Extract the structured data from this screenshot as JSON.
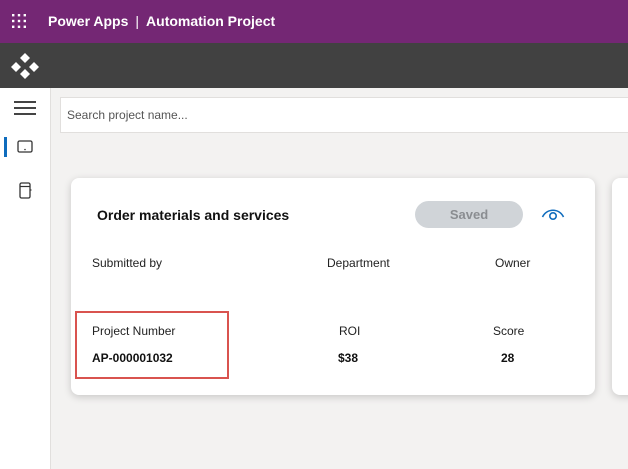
{
  "header": {
    "app_name": "Power Apps",
    "separator": "|",
    "project_title": "Automation Project"
  },
  "search": {
    "placeholder": "Search project name..."
  },
  "card": {
    "title": "Order materials and services",
    "saved_label": "Saved",
    "columns": {
      "submitted_by_label": "Submitted by",
      "department_label": "Department",
      "owner_label": "Owner",
      "project_number_label": "Project Number",
      "roi_label": "ROI",
      "score_label": "Score"
    },
    "values": {
      "project_number": "AP-000001032",
      "roi": "$38",
      "score": "28"
    }
  },
  "colors": {
    "header_bg": "#742774",
    "appbar_bg": "#414141",
    "highlight": "#d9534f",
    "accent": "#0f6cbd"
  }
}
